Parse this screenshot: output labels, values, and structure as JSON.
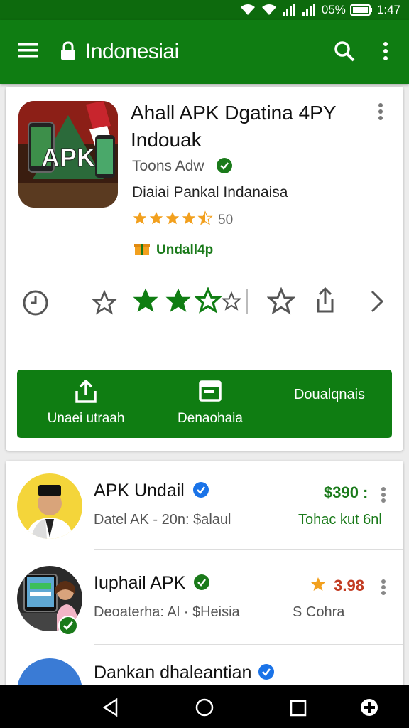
{
  "status_bar": {
    "battery": "05%",
    "time": "1:47"
  },
  "app_bar": {
    "title": "Indonesiai",
    "menu_icon": "menu-icon",
    "lock_icon": "lock-icon",
    "search_icon": "search-icon",
    "more_icon": "more-vert-icon",
    "color": "#0f7d12"
  },
  "app_card": {
    "title": "Ahall APK Dgatina 4PY Indouak",
    "developer": "Toons Adw",
    "category": "Diaiai Pankal Indanaisa",
    "rating_count": "50",
    "install_label": "Undall4p",
    "icon_text": "APK",
    "rating_stars": 4.5
  },
  "green_panel": {
    "share_label": "Unaei utraah",
    "details_label": "Denaohaia",
    "download_label": "Doualqnais"
  },
  "list": [
    {
      "name": "APK Undail",
      "subtitle": "Datel AK - 20n: $alaul",
      "price": "$390 :",
      "right_text": "Tohac kut 6nl"
    },
    {
      "name": "Iuphail APK",
      "subtitle": "Deoaterha: Al · $Heisia",
      "price": "3.98",
      "right_text": "S Cohra"
    },
    {
      "name": "Dankan dhaleantian"
    }
  ],
  "colors": {
    "accent": "#0f7d12",
    "star": "#f2a01e",
    "verified_blue": "#1a73e8"
  }
}
